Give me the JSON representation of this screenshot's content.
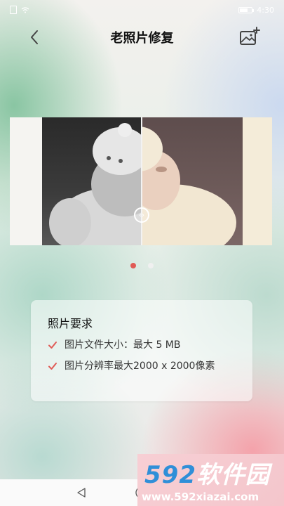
{
  "status_bar": {
    "time": "4:30"
  },
  "header": {
    "title": "老照片修复"
  },
  "pagination": {
    "total": 2,
    "active_index": 0
  },
  "requirements": {
    "title": "照片要求",
    "items": [
      "图片文件大小：最大 5 MB",
      "图片分辨率最大2000 x 2000像素"
    ]
  },
  "watermark": {
    "logo_number": "592",
    "logo_text": "软件园",
    "url": "www.592xiazai.com"
  },
  "colors": {
    "accent": "#e05a55",
    "check": "#e05a55"
  }
}
